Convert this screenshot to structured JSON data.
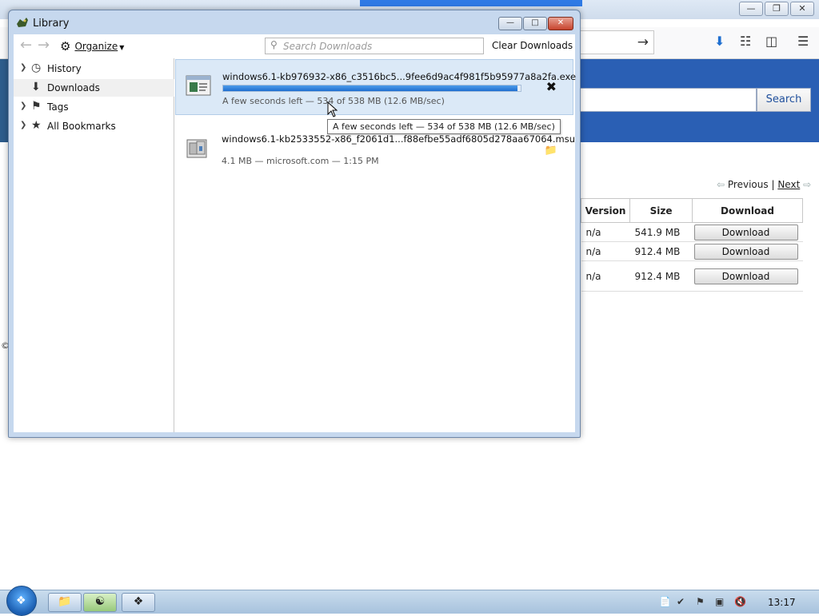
{
  "browser": {
    "search_button": "Search",
    "pager": {
      "previous": "Previous",
      "separator": "|",
      "next": "Next"
    },
    "table": {
      "headers": [
        "Version",
        "Size",
        "Download"
      ],
      "rows": [
        {
          "version": "n/a",
          "size": "541.9 MB",
          "button": "Download"
        },
        {
          "version": "n/a",
          "size": "912.4 MB",
          "button": "Download"
        },
        {
          "version": "n/a",
          "size": "912.4 MB",
          "button": "Download"
        }
      ]
    },
    "copyright_glyph": "©"
  },
  "library": {
    "title": "Library",
    "toolbar": {
      "organize": "Organize",
      "search_placeholder": "Search Downloads",
      "clear_downloads": "Clear Downloads"
    },
    "sidebar": {
      "items": [
        {
          "label": "History",
          "icon": "clock-icon"
        },
        {
          "label": "Downloads",
          "icon": "download-icon",
          "selected": true
        },
        {
          "label": "Tags",
          "icon": "tag-icon"
        },
        {
          "label": "All Bookmarks",
          "icon": "star-icon"
        }
      ]
    },
    "downloads": [
      {
        "name": "windows6.1-kb976932-x86_c3516bc5...9fee6d9ac4f981f5b95977a8a2fa.exe",
        "status": "A few seconds left — 534 of 538 MB (12.6 MB/sec)",
        "progress": 0.99,
        "state": "in-progress"
      },
      {
        "name": "windows6.1-kb2533552-x86_f2061d1...f88efbe55adf6805d278aa67064.msu",
        "status": "4.1 MB — microsoft.com — 1:15 PM",
        "state": "complete"
      }
    ],
    "tooltip": "A few seconds left — 534 of 538 MB (12.6 MB/sec)"
  },
  "taskbar": {
    "clock": "13:17"
  },
  "colors": {
    "accent": "#1f6fd0",
    "selection": "#dbe9f7",
    "hero": "#2a5fb4"
  }
}
